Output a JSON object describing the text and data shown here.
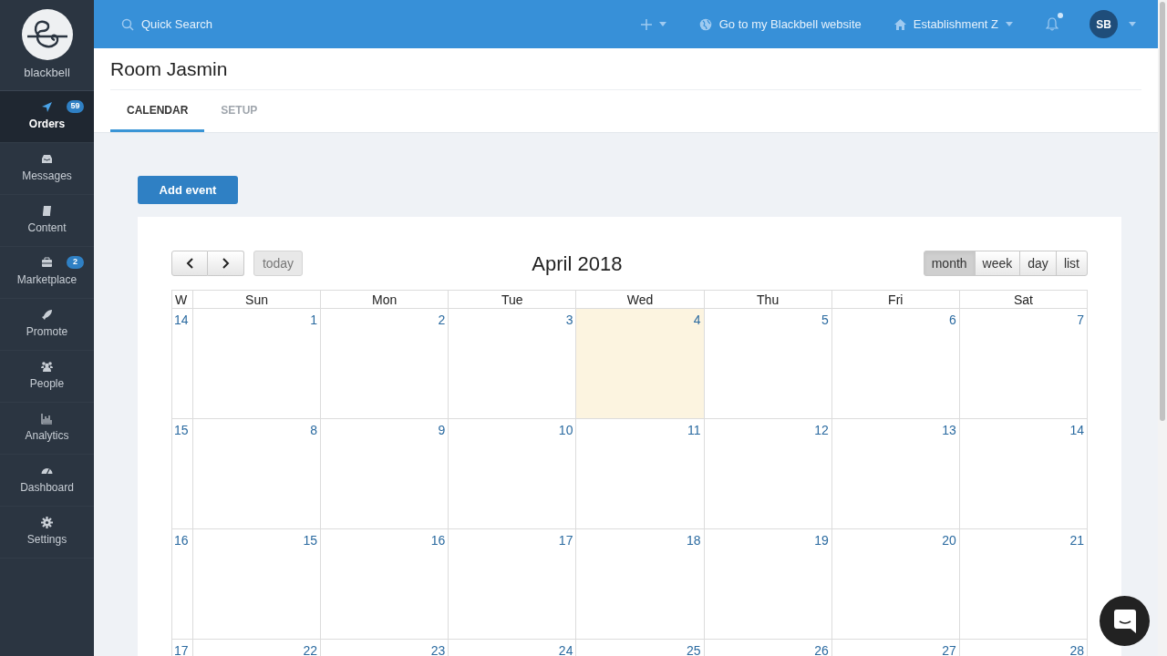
{
  "sidebar": {
    "brand": "blackbell",
    "items": [
      {
        "label": "Orders",
        "badge": "59",
        "selected": true
      },
      {
        "label": "Messages",
        "selected": false
      },
      {
        "label": "Content",
        "selected": false
      },
      {
        "label": "Marketplace",
        "badge": "2",
        "selected": false
      },
      {
        "label": "Promote",
        "selected": false
      },
      {
        "label": "People",
        "selected": false
      },
      {
        "label": "Analytics",
        "selected": false
      },
      {
        "label": "Dashboard",
        "selected": false
      },
      {
        "label": "Settings",
        "selected": false
      }
    ]
  },
  "topbar": {
    "search": {
      "placeholder": "Quick Search"
    },
    "website_link": "Go to my Blackbell website",
    "establishment": "Establishment Z",
    "notifications_unread": true,
    "avatar": "SB"
  },
  "page": {
    "title": "Room Jasmin",
    "tabs": [
      {
        "label": "CALENDAR",
        "selected": true
      },
      {
        "label": "SETUP",
        "selected": false
      }
    ]
  },
  "add_event": "Add event",
  "calendar": {
    "title": "April 2018",
    "today_button": "today",
    "views": [
      {
        "label": "month",
        "selected": true
      },
      {
        "label": "week",
        "selected": false
      },
      {
        "label": "day",
        "selected": false
      },
      {
        "label": "list",
        "selected": false
      }
    ],
    "week_header": "W",
    "day_headers": [
      "Sun",
      "Mon",
      "Tue",
      "Wed",
      "Thu",
      "Fri",
      "Sat"
    ],
    "weeks": [
      {
        "week": "14",
        "days": [
          {
            "day": "1",
            "today": false
          },
          {
            "day": "2",
            "today": false
          },
          {
            "day": "3",
            "today": false
          },
          {
            "day": "4",
            "today": true
          },
          {
            "day": "5",
            "today": false
          },
          {
            "day": "6",
            "today": false
          },
          {
            "day": "7",
            "today": false
          }
        ]
      },
      {
        "week": "15",
        "days": [
          {
            "day": "8",
            "today": false
          },
          {
            "day": "9",
            "today": false
          },
          {
            "day": "10",
            "today": false
          },
          {
            "day": "11",
            "today": false
          },
          {
            "day": "12",
            "today": false
          },
          {
            "day": "13",
            "today": false
          },
          {
            "day": "14",
            "today": false
          }
        ]
      },
      {
        "week": "16",
        "days": [
          {
            "day": "15",
            "today": false
          },
          {
            "day": "16",
            "today": false
          },
          {
            "day": "17",
            "today": false
          },
          {
            "day": "18",
            "today": false
          },
          {
            "day": "19",
            "today": false
          },
          {
            "day": "20",
            "today": false
          },
          {
            "day": "21",
            "today": false
          }
        ]
      },
      {
        "week": "17",
        "days": [
          {
            "day": "22",
            "today": false
          },
          {
            "day": "23",
            "today": false
          },
          {
            "day": "24",
            "today": false
          },
          {
            "day": "25",
            "today": false
          },
          {
            "day": "26",
            "today": false
          },
          {
            "day": "27",
            "today": false
          },
          {
            "day": "28",
            "today": false
          }
        ]
      }
    ]
  }
}
